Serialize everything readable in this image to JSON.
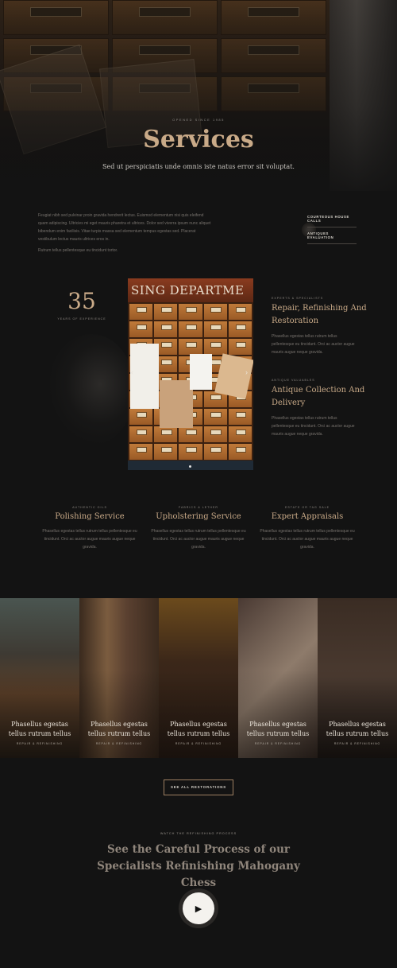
{
  "hero": {
    "kicker": "OPENED SINCE 1985",
    "title": "Services",
    "subtitle": "Sed ut perspiciatis unde omnis iste natus error sit voluptat."
  },
  "intro": {
    "paragraph1": "Feugiat nibh sed pulvinar proin gravida hendrerit lectus. Euismod elementum nisi quis eleifend quam adipiscing. Ultricies mi eget mauris pharetra et ultrices. Dolor sed viverra ipsum nunc aliquet bibendum enim facilisis. Vitae turpis massa sed elementum tempus egestas sed. Placerat vestibulum lectus mauris ultrices eros in.",
    "paragraph2": "Rutrum tellus pellentesque eu tincidunt tortor.",
    "link1": "COURTEOUS HOUSE CALLS",
    "link2": "ANTIQUES EVALUATION"
  },
  "stat": {
    "number": "35",
    "label": "YEARS OF EXPERIENCE"
  },
  "photo": {
    "sign_text": "SING DEPARTME",
    "prev_icon": "chevron-left-icon",
    "next_icon": "chevron-right-icon"
  },
  "side_services": [
    {
      "kicker": "EXPERTS & SPECIALISTS",
      "title_line1": "Repair, Refinishing And",
      "title_line2": "Restoration",
      "text": "Phasellus egestas tellus rutrum tellus pellentesque eu tincidunt. Orci ac auctor augue mauris augue neque gravida."
    },
    {
      "kicker": "ANTIQUE VALUABLES",
      "title_line1": "Antique Collection And",
      "title_line2": "Delivery",
      "text": "Phasellus egestas tellus rutrum tellus pellentesque eu tincidunt. Orci ac auctor augue mauris augue neque gravida."
    }
  ],
  "services": [
    {
      "kicker": "AUTHENTIC OILS",
      "title": "Polishing Service",
      "text": "Phasellus egestas tellus rutrum tellus pellentesque eu tincidunt. Orci ac auctor augue mauris augue neque gravida."
    },
    {
      "kicker": "FABRICS & LETHER",
      "title": "Upholstering Service",
      "text": "Phasellus egestas tellus rutrum tellus pellentesque eu tincidunt. Orci ac auctor augue mauris augue neque gravida."
    },
    {
      "kicker": "ESTATE OR TAG SALE",
      "title": "Expert Appraisals",
      "text": "Phasellus egestas tellus rutrum tellus pellentesque eu tincidunt. Orci ac auctor augue mauris augue neque gravida."
    }
  ],
  "gallery": [
    {
      "caption_line1": "Phasellus egestas",
      "caption_line2": "tellus rutrum tellus",
      "sub": "REPAIR & REFINISHING"
    },
    {
      "caption_line1": "Phasellus egestas",
      "caption_line2": "tellus rutrum tellus",
      "sub": "REPAIR & REFINISHING"
    },
    {
      "caption_line1": "Phasellus egestas",
      "caption_line2": "tellus rutrum tellus",
      "sub": "REPAIR & REFINISHING"
    },
    {
      "caption_line1": "Phasellus egestas",
      "caption_line2": "tellus rutrum tellus",
      "sub": "REPAIR & REFINISHING"
    },
    {
      "caption_line1": "Phasellus egestas",
      "caption_line2": "tellus rutrum tellus",
      "sub": "REPAIR & REFINISHING"
    }
  ],
  "cta": {
    "label": "SEE ALL RESTORATIONS"
  },
  "process": {
    "kicker": "WATCH THE REFINISHING PROCESS",
    "title_line1": "See the Careful Process of our",
    "title_line2": "Specialists Refinishing Mahogany Chess",
    "play_icon": "play-icon"
  },
  "colors": {
    "background": "#131313",
    "accent": "#c9aa88",
    "body_text": "#77726d"
  }
}
